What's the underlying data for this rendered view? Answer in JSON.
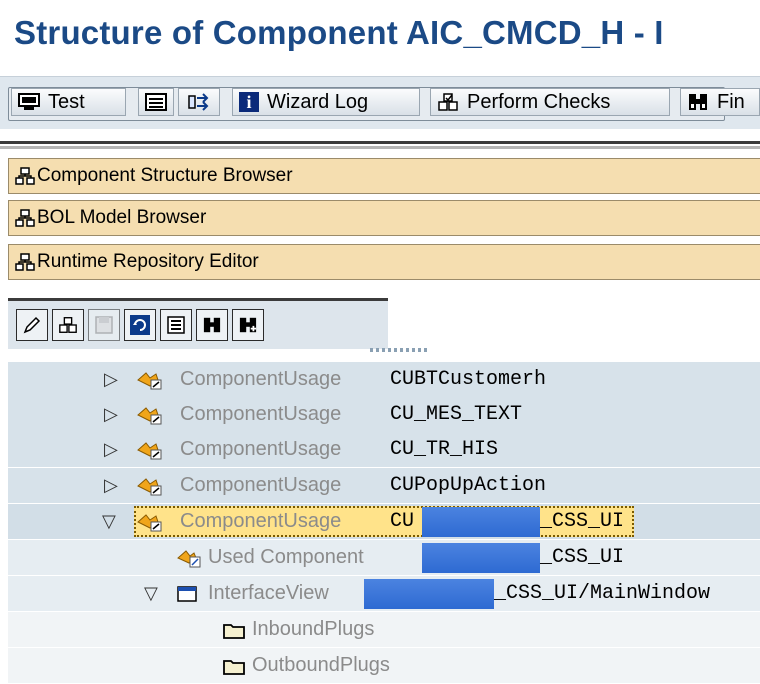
{
  "title": "Structure of Component AIC_CMCD_H - I",
  "toolbar": {
    "test_label": "Test",
    "wizard_log_label": "Wizard Log",
    "perform_checks_label": "Perform Checks",
    "find_label": "Fin"
  },
  "panels": [
    {
      "label": "Component Structure Browser"
    },
    {
      "label": "BOL Model Browser"
    },
    {
      "label": "Runtime Repository Editor"
    }
  ],
  "tree": {
    "rows": [
      {
        "type": "ComponentUsage",
        "name": "CUBTCustomerh"
      },
      {
        "type": "ComponentUsage",
        "name": "CU_MES_TEXT"
      },
      {
        "type": "ComponentUsage",
        "name": "CU_TR_HIS"
      },
      {
        "type": "ComponentUsage",
        "name": "CUPopUpAction"
      },
      {
        "type": "ComponentUsage",
        "prefix": "CU",
        "suffix": "_CSS_UI"
      },
      {
        "type": "Used Component",
        "suffix": "_CSS_UI"
      },
      {
        "type": "InterfaceView",
        "suffix": "_CSS_UI/MainWindow"
      },
      {
        "label": "InboundPlugs"
      },
      {
        "label": "OutboundPlugs"
      }
    ]
  },
  "colors": {
    "title": "#1b4a86",
    "panel_button": "#f5deb0",
    "tree_selected_row": "#d2dee7",
    "redaction": "#2e6ad2",
    "focus_highlight": "#ffe38a"
  },
  "icons": {
    "test": "screen-test-icon",
    "layout": "layout-icon",
    "navigate": "navigation-arrows-icon",
    "wizard_log": "info-icon",
    "perform_checks": "check-icon",
    "find": "binoculars-icon",
    "panel": "hierarchy-icon",
    "edit": "pencil-icon",
    "save": "save-icon",
    "refresh": "refresh-icon",
    "folder": "folder-icon"
  }
}
